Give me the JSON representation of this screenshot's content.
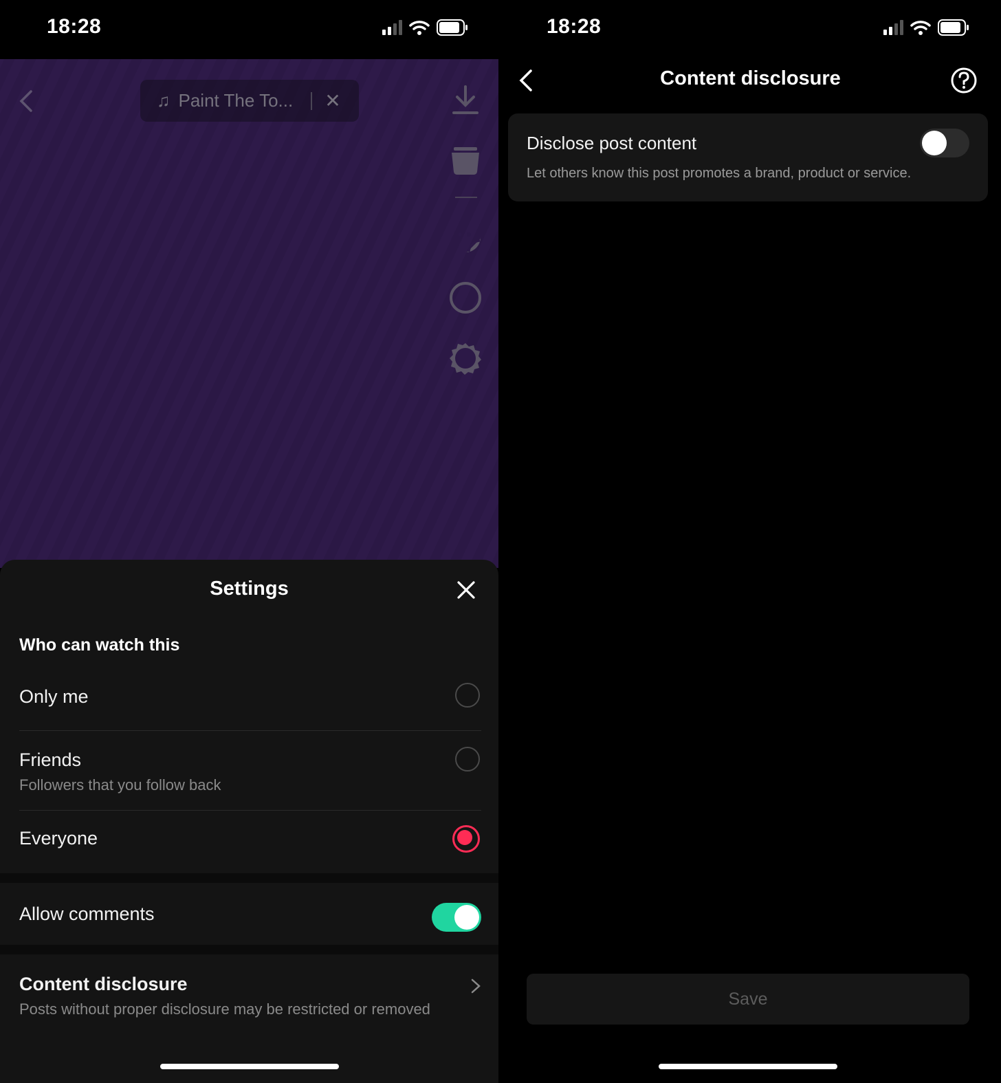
{
  "status_bar": {
    "time": "18:28"
  },
  "left_screen": {
    "sound_pill": {
      "note_icon": "music-note-icon",
      "track_name": "Paint The To...",
      "close_icon": "close-icon"
    },
    "toolbar_icons": [
      "download-icon",
      "cup-icon",
      "sticker-icon",
      "circle-icon",
      "gear-icon"
    ],
    "settings": {
      "title": "Settings",
      "section_label": "Who can watch this",
      "options": [
        {
          "label": "Only me",
          "sub": "",
          "selected": false
        },
        {
          "label": "Friends",
          "sub": "Followers that you follow back",
          "selected": false
        },
        {
          "label": "Everyone",
          "sub": "",
          "selected": true
        }
      ],
      "allow_comments": {
        "label": "Allow comments",
        "enabled": true
      },
      "content_disclosure": {
        "label": "Content disclosure",
        "sub": "Posts without proper disclosure may be restricted or removed"
      }
    },
    "colors": {
      "accent_red": "#fe2c55",
      "toggle_green": "#20d5a0"
    }
  },
  "right_screen": {
    "title": "Content disclosure",
    "disclose": {
      "label": "Disclose post content",
      "sub": "Let others know this post promotes a brand, product or service.",
      "enabled": false
    },
    "save_label": "Save"
  }
}
